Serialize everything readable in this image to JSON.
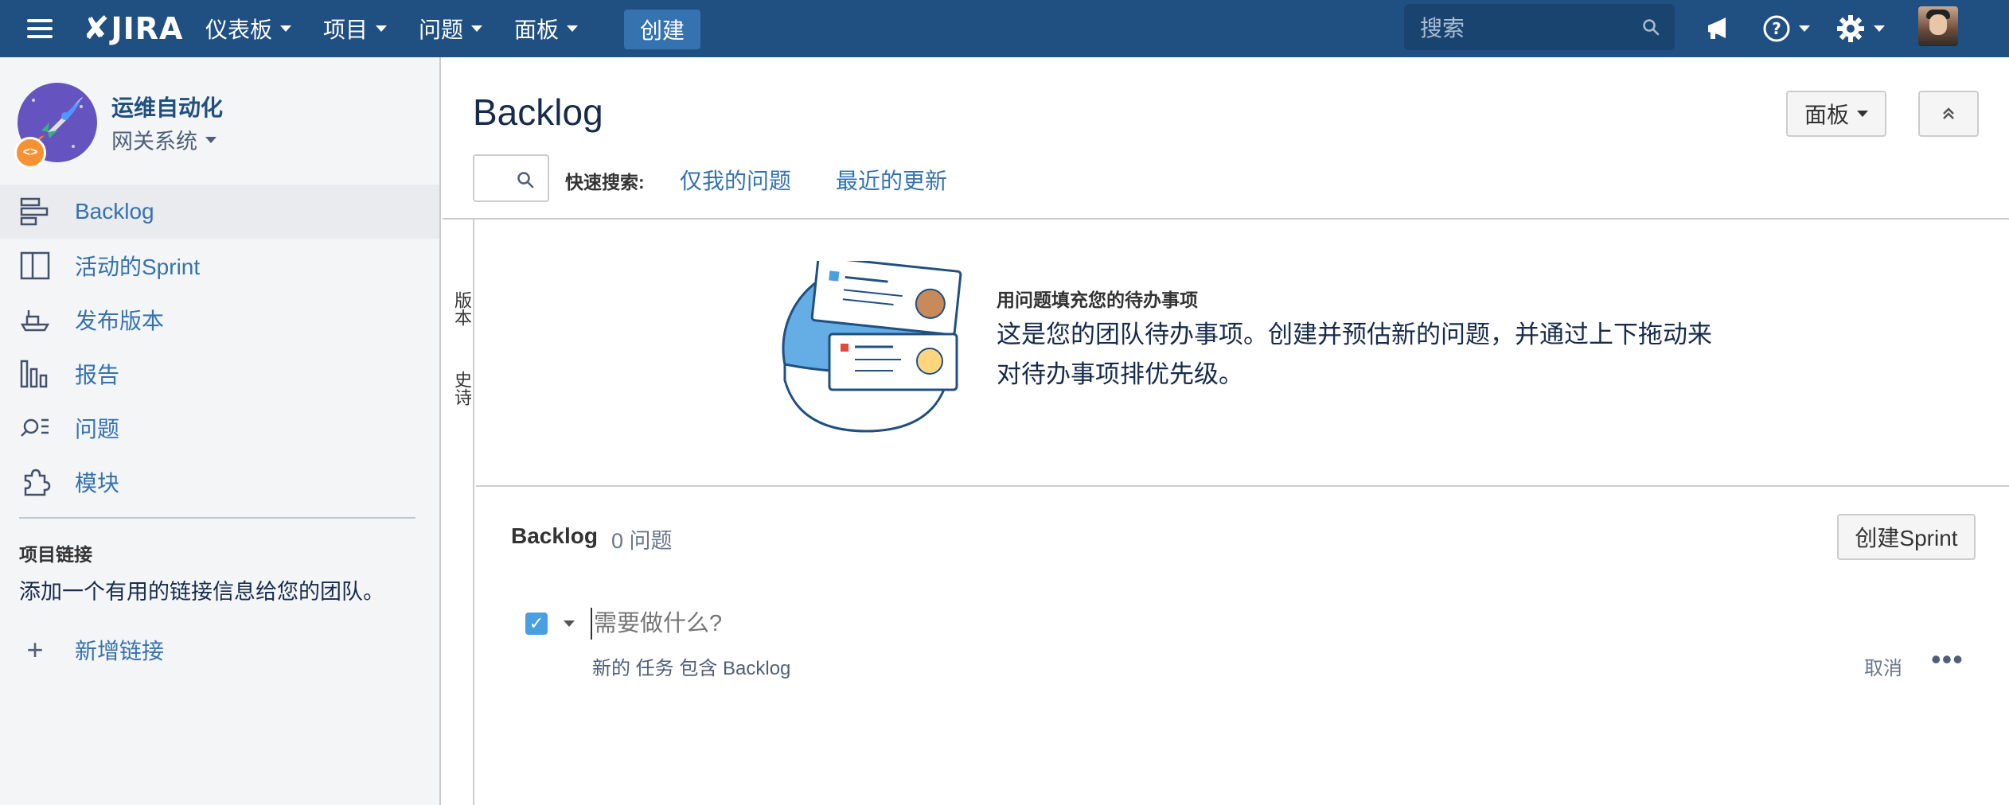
{
  "topbar": {
    "logo_text": "JIRA",
    "nav": [
      {
        "label": "仪表板"
      },
      {
        "label": "项目"
      },
      {
        "label": "问题"
      },
      {
        "label": "面板"
      }
    ],
    "create_label": "创建",
    "search_placeholder": "搜索"
  },
  "sidebar": {
    "project_name": "运维自动化",
    "project_sub": "网关系统",
    "items": [
      {
        "label": "Backlog"
      },
      {
        "label": "活动的Sprint"
      },
      {
        "label": "发布版本"
      },
      {
        "label": "报告"
      },
      {
        "label": "问题"
      },
      {
        "label": "模块"
      }
    ],
    "links_heading": "项目链接",
    "links_desc": "添加一个有用的链接信息给您的团队。",
    "add_link": "新增链接"
  },
  "main": {
    "title": "Backlog",
    "board_btn": "面板",
    "quick_search_label": "快速搜索:",
    "quick_filters": [
      "仅我的问题",
      "最近的更新"
    ],
    "rail": [
      "版本",
      "史诗"
    ],
    "empty_title": "用问题填充您的待办事项",
    "empty_body": "这是您的团队待办事项。创建并预估新的问题，并通过上下拖动来对待办事项排优先级。",
    "backlog_label": "Backlog",
    "backlog_count": "0 问题",
    "create_sprint": "创建Sprint",
    "task_placeholder": "需要做什么?",
    "task_meta": "新的 任务 包含 Backlog",
    "cancel": "取消"
  },
  "colors": {
    "nav_bg": "#205081",
    "link": "#3572b0",
    "accent_button": "#3572b0"
  }
}
